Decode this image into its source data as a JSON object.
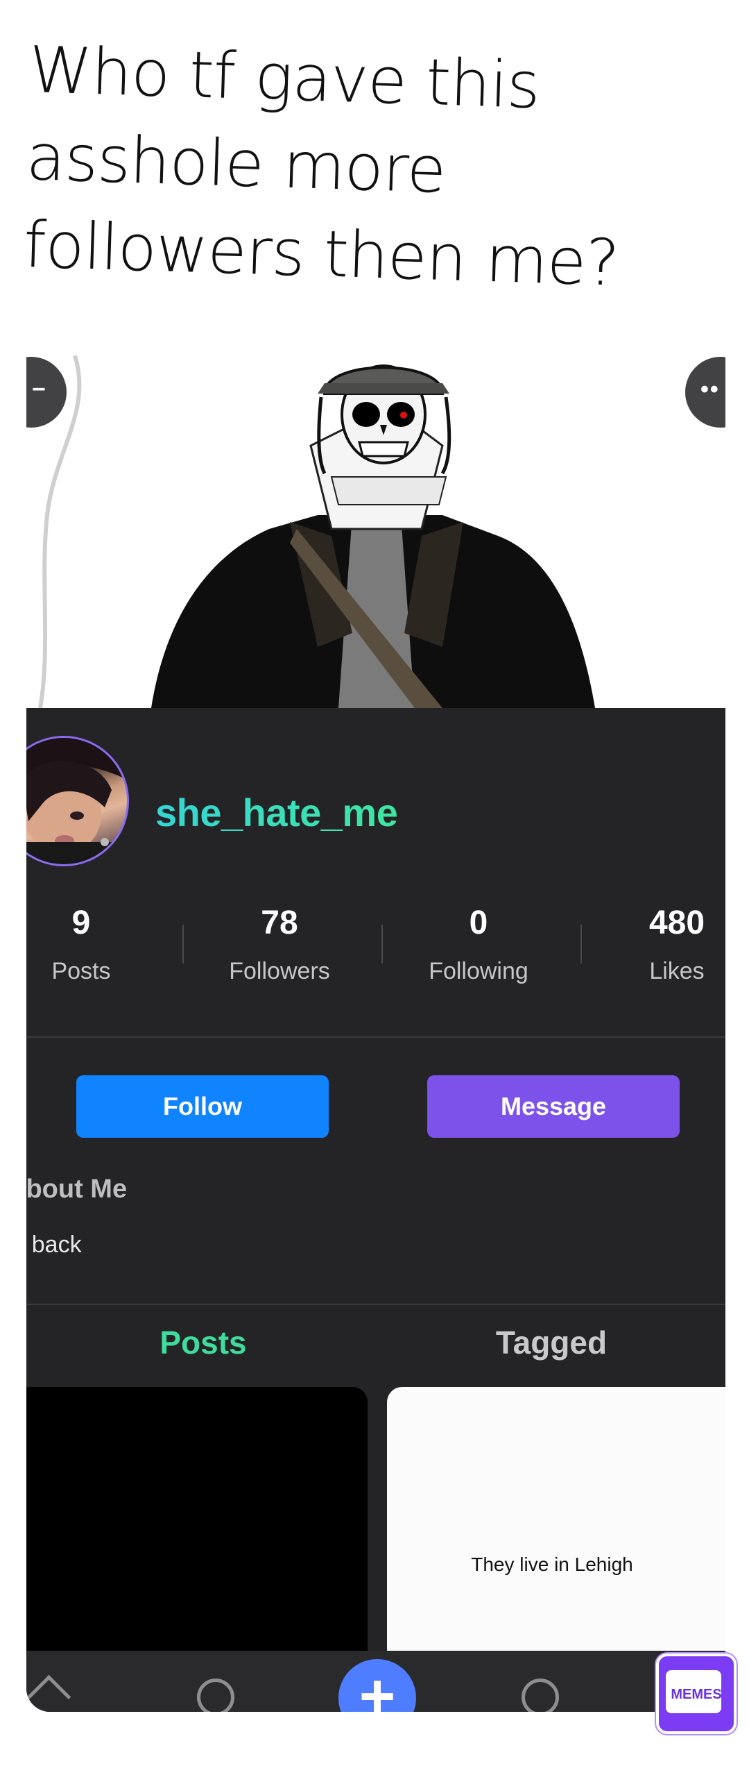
{
  "caption": {
    "line1": "Who tf gave this",
    "line2": "asshole more",
    "line3": "followers then me?"
  },
  "profile": {
    "username": "she_hate_me"
  },
  "stats": [
    {
      "value": "9",
      "label": "Posts"
    },
    {
      "value": "78",
      "label": "Followers"
    },
    {
      "value": "0",
      "label": "Following"
    },
    {
      "value": "480",
      "label": "Likes"
    }
  ],
  "actions": {
    "follow_label": "Follow",
    "message_label": "Message"
  },
  "about": {
    "title": "About Me",
    "text": "m back"
  },
  "tabs": {
    "posts": "Posts",
    "tagged": "Tagged"
  },
  "posts_grid": [
    {
      "caption": ""
    },
    {
      "caption": "They live in Lehigh"
    }
  ],
  "watermark": {
    "label": "MEMES"
  },
  "colors": {
    "follow_button": "#1083ff",
    "message_button": "#7d52ea",
    "username_gradient_start": "#35d6d6",
    "username_gradient_end": "#3ee7a0",
    "active_tab": "#3fdc9c",
    "panel_background": "#242426"
  },
  "icons": [
    "back-icon",
    "more-icon",
    "home-icon",
    "search-icon",
    "plus-icon",
    "notifications-icon"
  ]
}
